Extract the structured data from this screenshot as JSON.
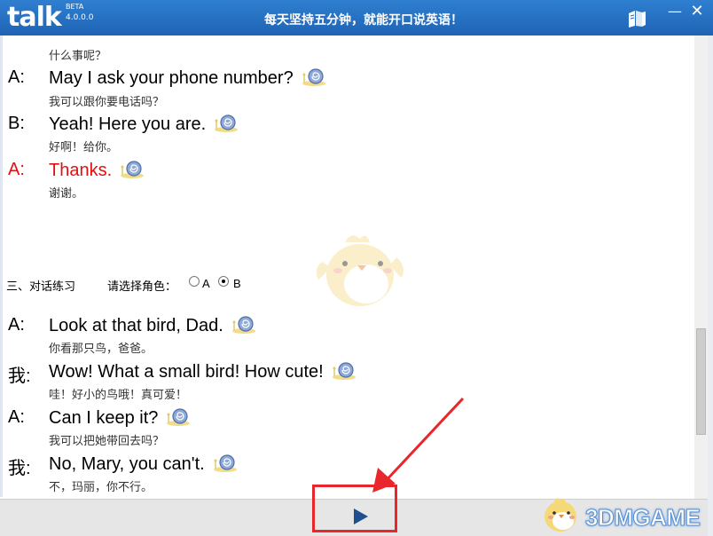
{
  "app": {
    "logo": "talk",
    "beta": "BETA",
    "version": "4.0.0.0",
    "slogan": "每天坚持五分钟，就能开口说英语！"
  },
  "dialog1": [
    {
      "speaker": "",
      "en": "",
      "cn": "什么事呢？",
      "highlight": false
    },
    {
      "speaker": "A:",
      "en": "May I ask your phone number?",
      "cn": "我可以跟你要电话吗？",
      "highlight": false
    },
    {
      "speaker": "B:",
      "en": "Yeah! Here you are.",
      "cn": "好啊！给你。",
      "highlight": false
    },
    {
      "speaker": "A:",
      "en": "Thanks.",
      "cn": "谢谢。",
      "highlight": true
    }
  ],
  "practice": {
    "section_label": "三、对话练习",
    "role_label": "请选择角色：",
    "options": [
      "A",
      "B"
    ],
    "selected": "B"
  },
  "dialog2": [
    {
      "speaker": "A:",
      "en": "Look at that bird, Dad.",
      "cn": "你看那只鸟，爸爸。"
    },
    {
      "speaker": "我:",
      "en": "Wow! What a small bird! How cute!",
      "cn": "哇！好小的鸟哦！真可爱！"
    },
    {
      "speaker": "A:",
      "en": "Can I keep it?",
      "cn": "我可以把她带回去吗？"
    },
    {
      "speaker": "我:",
      "en": "No, Mary, you can't.",
      "cn": "不，玛丽，你不行。"
    }
  ],
  "icons": {
    "snail": "snail-audio-icon",
    "play": "play-icon",
    "book": "book-icon",
    "minimize": "minimize-icon",
    "close": "close-icon"
  },
  "colors": {
    "titlebar": "#1f63b4",
    "highlight": "#e01010",
    "annotation": "#e8262b",
    "play": "#1e4f8f"
  },
  "watermark": {
    "text": "3DMGAME"
  }
}
